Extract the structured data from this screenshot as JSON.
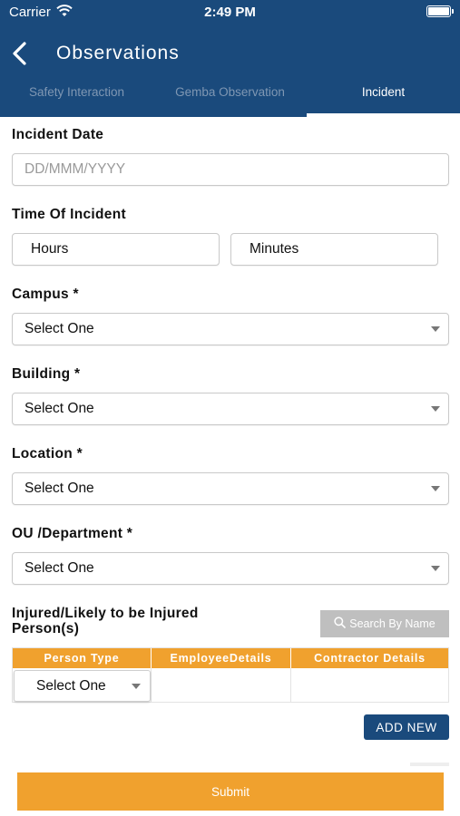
{
  "status_bar": {
    "carrier": "Carrier",
    "time": "2:49 PM"
  },
  "header": {
    "title": "Observations"
  },
  "tabs": [
    {
      "label": "Safety Interaction",
      "active": false
    },
    {
      "label": "Gemba Observation",
      "active": false
    },
    {
      "label": "Incident",
      "active": true
    }
  ],
  "form": {
    "incident_date": {
      "label": "Incident Date",
      "placeholder": "DD/MMM/YYYY"
    },
    "time_of_incident": {
      "label": "Time Of Incident",
      "hours": "Hours",
      "minutes": "Minutes"
    },
    "campus": {
      "label": "Campus *",
      "value": "Select One"
    },
    "building": {
      "label": "Building *",
      "value": "Select One"
    },
    "location": {
      "label": "Location *",
      "value": "Select One"
    },
    "department": {
      "label": "OU /Department *",
      "value": "Select One"
    },
    "injured": {
      "label_line1": "Injured/Likely to be Injured",
      "label_line2": "Person(s)",
      "search_label": "Search By Name"
    }
  },
  "persons_table": {
    "columns": [
      "Person Type",
      "EmployeeDetails",
      "Contractor Details"
    ],
    "rows": [
      {
        "person_type": "Select One",
        "employee_details": "",
        "contractor_details": ""
      }
    ]
  },
  "actions": {
    "add_new": "ADD NEW",
    "submit": "Submit"
  },
  "colors": {
    "header": "#1a4a7c",
    "accent": "#f0a12e",
    "search_button": "#bfbfbf"
  },
  "icons": {
    "back": "chevron-left-icon",
    "search": "search-icon",
    "dropdown": "caret-down-icon",
    "wifi": "wifi-icon",
    "battery": "battery-icon"
  }
}
